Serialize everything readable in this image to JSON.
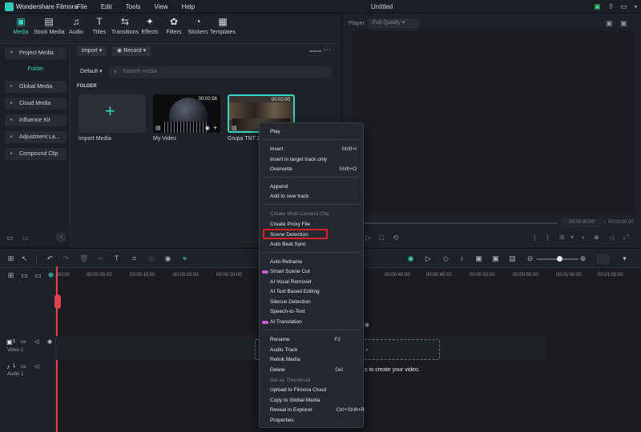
{
  "app": {
    "name": "Wondershare Filmora",
    "title": "Untitled",
    "menus": [
      "File",
      "Edit",
      "Tools",
      "View",
      "Help"
    ]
  },
  "toolbar": {
    "items": [
      {
        "label": "Media",
        "icon": "media-icon"
      },
      {
        "label": "Stock Media",
        "icon": "stock-media-icon"
      },
      {
        "label": "Audio",
        "icon": "audio-icon"
      },
      {
        "label": "Titles",
        "icon": "titles-icon"
      },
      {
        "label": "Transitions",
        "icon": "transitions-icon"
      },
      {
        "label": "Effects",
        "icon": "effects-icon"
      },
      {
        "label": "Filters",
        "icon": "filters-icon"
      },
      {
        "label": "Stickers",
        "icon": "stickers-icon"
      },
      {
        "label": "Templates",
        "icon": "templates-icon"
      }
    ]
  },
  "sidebar": {
    "items": [
      "Project Media",
      "Folder",
      "Global Media",
      "Cloud Media",
      "Influence Kit",
      "Adjustment La...",
      "Compound Clip"
    ]
  },
  "media": {
    "import_label": "Import",
    "record_label": "Record",
    "sort_label": "Default",
    "search_placeholder": "Search media",
    "folder_header": "FOLDER",
    "cards": [
      {
        "label": "Import Media",
        "duration": ""
      },
      {
        "label": "My Video",
        "duration": "00:00:56"
      },
      {
        "label": "Grupa TNT Ze",
        "duration": "00:01:00"
      }
    ]
  },
  "player": {
    "label": "Player",
    "quality": "Full Quality",
    "time_current": "00:00:00:00",
    "time_total": "00:00:00:00"
  },
  "timeline": {
    "ruler": [
      "00:00",
      "00:00:05:00",
      "00:00:10:00",
      "00:00:15:00",
      "00:00:20:00",
      "00:00:40:00",
      "00:00:45:00",
      "00:00:50:00",
      "00:00:55:00",
      "00:01:00:00",
      "00:01:05:00"
    ],
    "tracks": [
      {
        "label": "Video 1",
        "num": "1"
      },
      {
        "label": "Audio 1",
        "num": "1"
      }
    ],
    "drop_hint": "s to create your video."
  },
  "context_menu": {
    "items": [
      {
        "label": "Play",
        "shortcut": ""
      },
      {
        "label": "Insert",
        "shortcut": "Shift+I"
      },
      {
        "label": "Insert in target track only",
        "shortcut": ""
      },
      {
        "label": "Overwrite",
        "shortcut": "Shift+O"
      },
      {
        "label": "Append",
        "shortcut": ""
      },
      {
        "label": "Add to new track",
        "shortcut": ""
      },
      {
        "label": "Create Multi-Camera Clip",
        "shortcut": ""
      },
      {
        "label": "Create Proxy File",
        "shortcut": ""
      },
      {
        "label": "Scene Detection",
        "shortcut": ""
      },
      {
        "label": "Auto Beat Sync",
        "shortcut": ""
      },
      {
        "label": "Auto Reframe",
        "shortcut": ""
      },
      {
        "label": "Smart Scene Cut",
        "shortcut": ""
      },
      {
        "label": "AI Vocal Remover",
        "shortcut": ""
      },
      {
        "label": "AI Text Based Editing",
        "shortcut": ""
      },
      {
        "label": "Silence Detection",
        "shortcut": ""
      },
      {
        "label": "Speech-to-Text",
        "shortcut": ""
      },
      {
        "label": "AI Translation",
        "shortcut": ""
      },
      {
        "label": "Rename",
        "shortcut": "F2"
      },
      {
        "label": "Audio Track",
        "shortcut": ""
      },
      {
        "label": "Relink Media",
        "shortcut": ""
      },
      {
        "label": "Delete",
        "shortcut": "Del"
      },
      {
        "label": "Set as Thumbnail",
        "shortcut": ""
      },
      {
        "label": "Upload to Filmora Cloud",
        "shortcut": ""
      },
      {
        "label": "Copy to Global Media",
        "shortcut": ""
      },
      {
        "label": "Reveal in Explorer",
        "shortcut": "Ctrl+Shift+R"
      },
      {
        "label": "Properties",
        "shortcut": ""
      }
    ]
  },
  "colors": {
    "accent": "#37d4c4",
    "highlight": "#d8202a",
    "playhead": "#e0454f"
  }
}
